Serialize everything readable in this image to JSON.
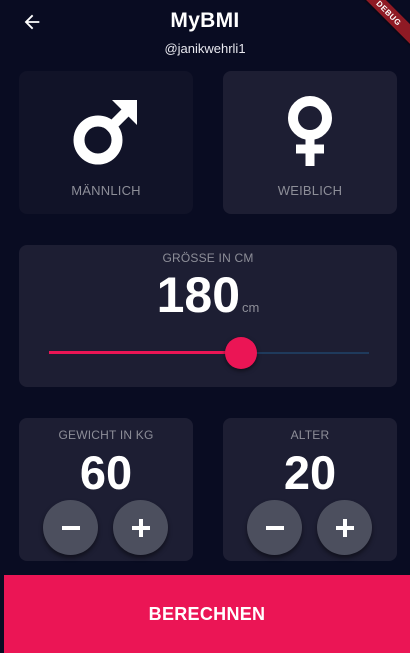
{
  "appbar": {
    "title": "MyBMI",
    "subtitle": "@janikwehrli1",
    "debug_banner": "DEBUG",
    "back_icon": "arrow-back-icon"
  },
  "gender": {
    "male": {
      "label": "MÄNNLICH",
      "icon": "male-icon",
      "selected": true
    },
    "female": {
      "label": "WEIBLICH",
      "icon": "female-icon",
      "selected": false
    }
  },
  "height": {
    "label": "GRÖSSE IN CM",
    "value": "180",
    "unit": "cm",
    "slider_fraction": 0.6
  },
  "weight": {
    "label": "GEWICHT IN KG",
    "value": "60",
    "minus_icon": "minus-icon",
    "plus_icon": "plus-icon"
  },
  "age": {
    "label": "ALTER",
    "value": "20",
    "minus_icon": "minus-icon",
    "plus_icon": "plus-icon"
  },
  "calculate_button": {
    "label": "BERECHNEN"
  },
  "colors": {
    "background": "#090c22",
    "card": "#1d1e33",
    "card_selected": "#111328",
    "accent": "#eb1555",
    "label": "#8d8e98",
    "round_button": "#4c4f5e"
  }
}
